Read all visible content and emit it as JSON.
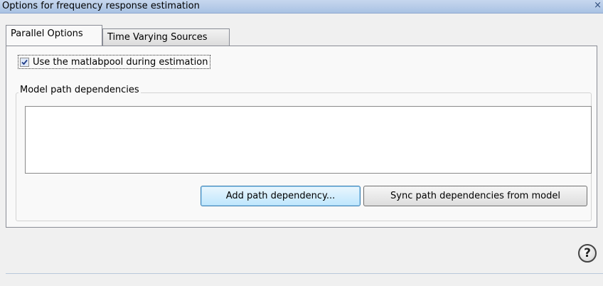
{
  "window": {
    "title": "Options for frequency response estimation",
    "close_glyph": "×"
  },
  "tabs": [
    {
      "label": "Parallel Options",
      "active": true
    },
    {
      "label": "Time Varying Sources",
      "active": false
    }
  ],
  "parallel": {
    "use_pool_label": "Use the matlabpool during estimation",
    "use_pool_checked": true,
    "group_label": "Model path dependencies",
    "dependencies": [],
    "add_button": "Add path dependency...",
    "sync_button": "Sync path dependencies from model"
  },
  "footer": {
    "help_icon": "question-mark-help-icon",
    "help_glyph": "?"
  }
}
